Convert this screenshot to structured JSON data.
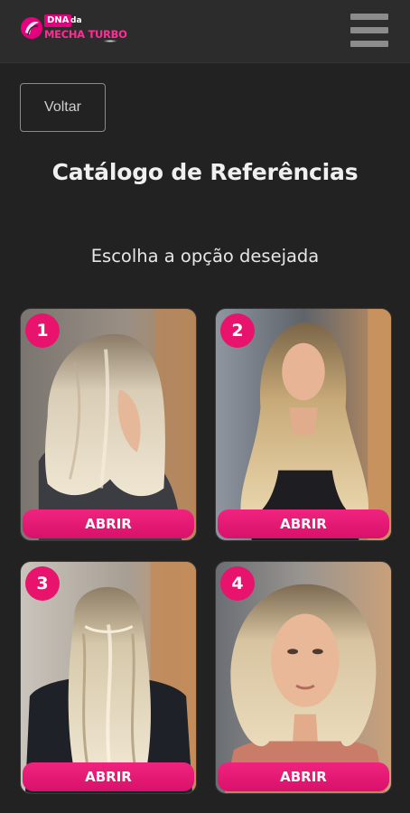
{
  "header": {
    "logo_badge": "DNA",
    "logo_small": "da",
    "logo_main": "MECHA TURBO",
    "menu_icon": "hamburger-menu-icon"
  },
  "back_button": {
    "label": "Voltar"
  },
  "title": "Catálogo de Referências",
  "subtitle": "Escolha a opção desejada",
  "cards": [
    {
      "number": "1",
      "button": "ABRIR"
    },
    {
      "number": "2",
      "button": "ABRIR"
    },
    {
      "number": "3",
      "button": "ABRIR"
    },
    {
      "number": "4",
      "button": "ABRIR"
    }
  ],
  "colors": {
    "background": "#222222",
    "header": "#2c2c2c",
    "accent": "#e8136c"
  }
}
